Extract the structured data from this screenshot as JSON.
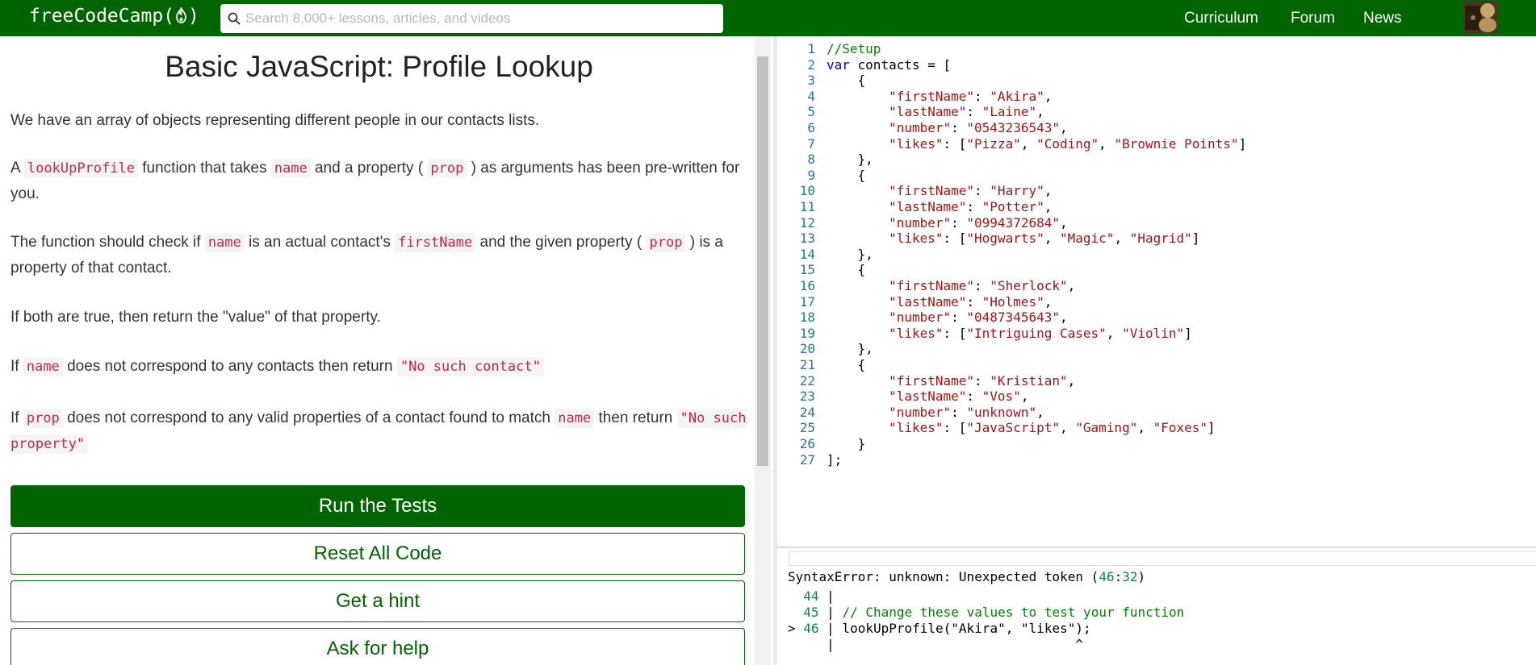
{
  "nav": {
    "logo_text": "freeCodeCamp(",
    "logo_suffix": ")",
    "search_placeholder": "Search 8,000+ lessons, articles, and videos",
    "links": [
      "Curriculum",
      "Forum",
      "News"
    ]
  },
  "challenge": {
    "title": "Basic JavaScript: Profile Lookup",
    "p1": "We have an array of objects representing different people in our contacts lists.",
    "p2": {
      "a": "A ",
      "c1": "lookUpProfile",
      "b": " function that takes ",
      "c2": "name",
      "c": " and a property ( ",
      "c3": "prop",
      "d": " ) as arguments has been pre-written for you."
    },
    "p3": {
      "a": "The function should check if ",
      "c1": "name",
      "b": " is an actual contact's ",
      "c2": "firstName",
      "c": " and the given property ( ",
      "c3": "prop",
      "d": " ) is a property of that contact."
    },
    "p4": "If both are true, then return the \"value\" of that property.",
    "p5": {
      "a": "If ",
      "c1": "name",
      "b": " does not correspond to any contacts then return ",
      "c2": "\"No such contact\""
    },
    "p6": {
      "a": "If ",
      "c1": "prop",
      "b": " does not correspond to any valid properties of a contact found to match ",
      "c2": "name",
      "c": " then return ",
      "c3": "\"No such property\""
    }
  },
  "buttons": {
    "run": "Run the Tests",
    "reset": "Reset All Code",
    "hint": "Get a hint",
    "help": "Ask for help"
  },
  "editor": {
    "line_numbers": [
      "1",
      "2",
      "3",
      "4",
      "5",
      "6",
      "7",
      "8",
      "9",
      "10",
      "11",
      "12",
      "13",
      "14",
      "15",
      "16",
      "17",
      "18",
      "19",
      "20",
      "21",
      "22",
      "23",
      "24",
      "25",
      "26",
      "27"
    ],
    "lines": [
      "//Setup",
      "var contacts = [",
      "    {",
      "        \"firstName\": \"Akira\",",
      "        \"lastName\": \"Laine\",",
      "        \"number\": \"0543236543\",",
      "        \"likes\": [\"Pizza\", \"Coding\", \"Brownie Points\"]",
      "    },",
      "    {",
      "        \"firstName\": \"Harry\",",
      "        \"lastName\": \"Potter\",",
      "        \"number\": \"0994372684\",",
      "        \"likes\": [\"Hogwarts\", \"Magic\", \"Hagrid\"]",
      "    },",
      "    {",
      "        \"firstName\": \"Sherlock\",",
      "        \"lastName\": \"Holmes\",",
      "        \"number\": \"0487345643\",",
      "        \"likes\": [\"Intriguing Cases\", \"Violin\"]",
      "    },",
      "    {",
      "        \"firstName\": \"Kristian\",",
      "        \"lastName\": \"Vos\",",
      "        \"number\": \"unknown\",",
      "        \"likes\": [\"JavaScript\", \"Gaming\", \"Foxes\"]",
      "    }",
      "];"
    ]
  },
  "console": {
    "error_prefix": "SyntaxError: unknown: Unexpected token (",
    "err_line": "46",
    "err_col": "32",
    "error_suffix": ")",
    "lines": [
      {
        "marker": "  ",
        "num": "44",
        "code": " |"
      },
      {
        "marker": "  ",
        "num": "45",
        "code": " | // Change these values to test your function"
      },
      {
        "marker": "> ",
        "num": "46",
        "code": " | lookUpProfile(\"Akira\", \"likes\");"
      },
      {
        "marker": "  ",
        "num": "  ",
        "code": " |                               ^"
      }
    ]
  },
  "colors": {
    "brand": "#006400",
    "code_text": "#c7254e"
  }
}
